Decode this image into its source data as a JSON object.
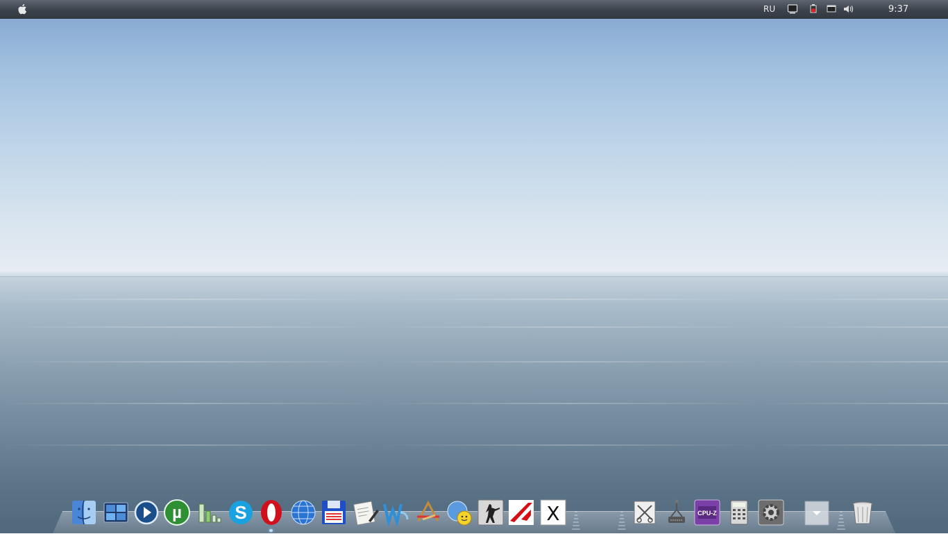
{
  "menubar": {
    "apple_icon": "apple-logo-icon",
    "language": "RU",
    "clock": "9:37",
    "tray_icons": [
      "monitor-icon",
      "network-icon",
      "window-icon",
      "volume-icon"
    ]
  },
  "dock": {
    "apps": [
      {
        "name": "finder",
        "icon": "finder-icon"
      },
      {
        "name": "spaces",
        "icon": "spaces-icon"
      },
      {
        "name": "media-player",
        "icon": "play-icon"
      },
      {
        "name": "utorrent",
        "icon": "utorrent-icon",
        "glyph": "µ"
      },
      {
        "name": "signal",
        "icon": "signal-bars-icon"
      },
      {
        "name": "skype",
        "icon": "skype-icon",
        "glyph": "S"
      },
      {
        "name": "opera",
        "icon": "opera-icon",
        "glyph": "O"
      },
      {
        "name": "globe-browser",
        "icon": "globe-icon"
      },
      {
        "name": "save",
        "icon": "floppy-disk-icon"
      },
      {
        "name": "text-editor",
        "icon": "document-pen-icon"
      },
      {
        "name": "word",
        "icon": "word-icon",
        "glyph": "W"
      },
      {
        "name": "app-store",
        "icon": "app-store-icon"
      },
      {
        "name": "messenger",
        "icon": "chat-smiley-icon"
      },
      {
        "name": "counter-strike",
        "icon": "soldier-icon"
      },
      {
        "name": "mirrors-edge",
        "icon": "mirrors-edge-icon"
      },
      {
        "name": "x11",
        "icon": "x-icon",
        "glyph": "X"
      }
    ],
    "utilities": [
      {
        "name": "grab",
        "icon": "scissors-tool-icon"
      },
      {
        "name": "network-drive",
        "icon": "network-drive-icon"
      },
      {
        "name": "cpu-z",
        "icon": "cpu-z-icon",
        "glyph": "CPU-Z"
      },
      {
        "name": "calculator",
        "icon": "calculator-icon"
      },
      {
        "name": "system-preferences",
        "icon": "gear-icon"
      },
      {
        "name": "downloads",
        "icon": "downloads-stack-icon"
      },
      {
        "name": "trash",
        "icon": "trash-icon"
      }
    ]
  }
}
